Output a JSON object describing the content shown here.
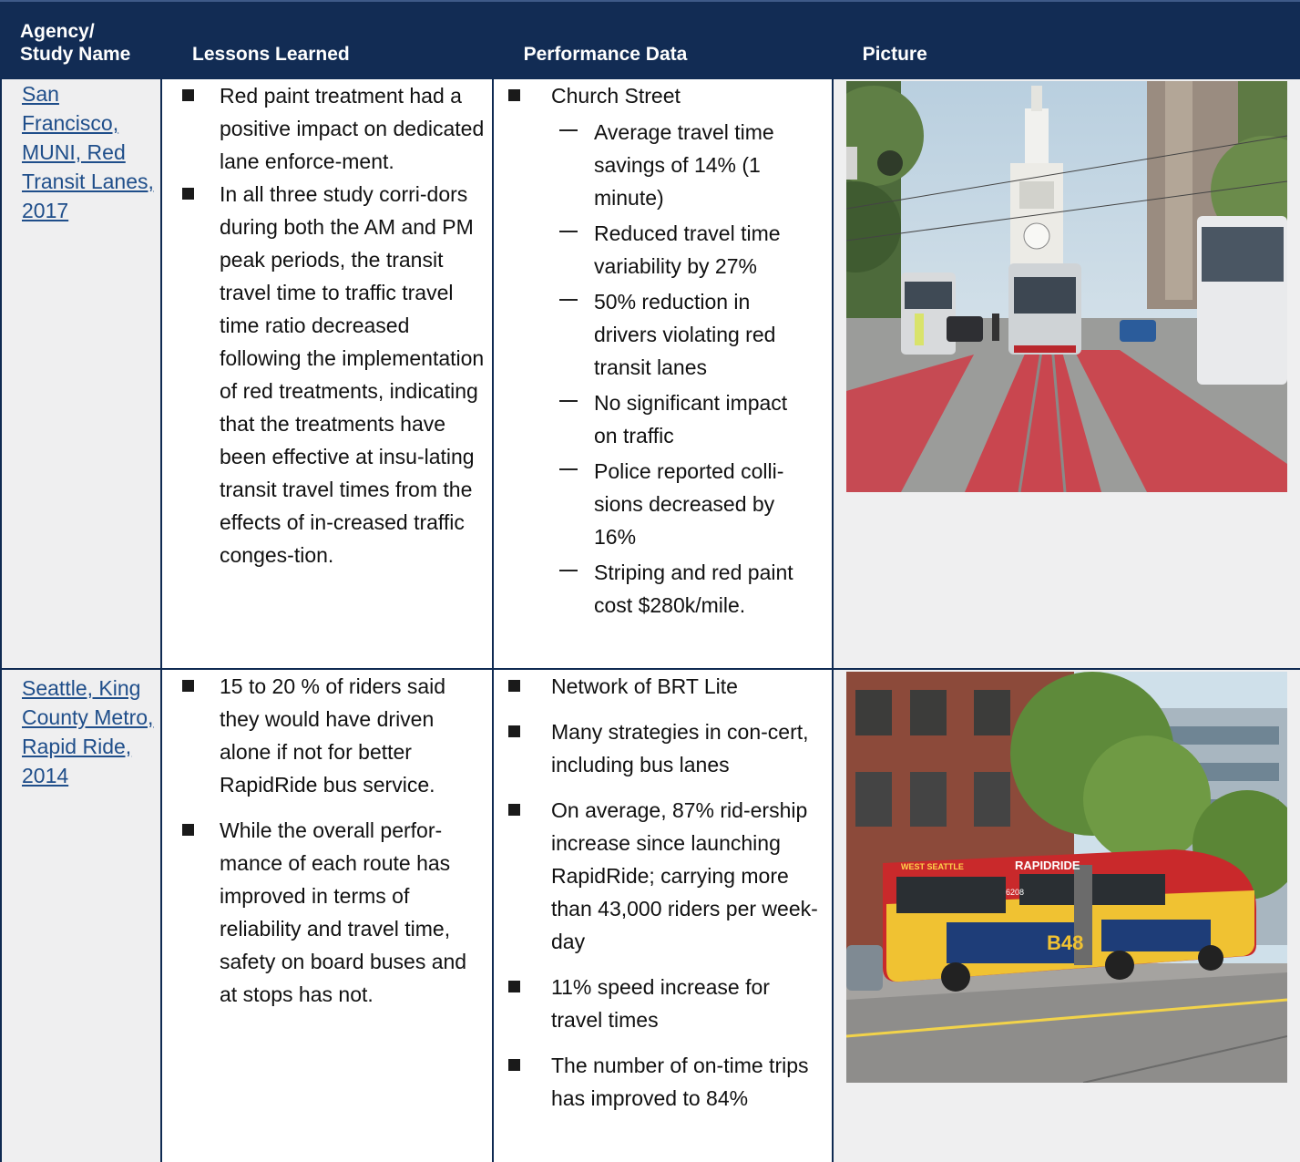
{
  "header": {
    "col1": "Agency/\nStudy Name",
    "col2": "Lessons Learned",
    "col3": "Performance Data",
    "col4": "Picture"
  },
  "rows": [
    {
      "agency": "San Francisco, MUNI, Red Transit Lanes, 2017",
      "lessons": [
        "Red paint treatment had a positive impact on dedicated lane enforce-ment.",
        "In all three study corri-dors during both the AM and PM peak periods, the transit travel time to traffic travel time ratio decreased following the implementation of red treatments, indicating that the treatments have been effective at insu-lating transit travel times from the effects of in-creased traffic conges-tion."
      ],
      "performance": {
        "heading": "Church Street",
        "items": [
          "Average travel time savings of 14% (1 minute)",
          "Reduced travel time variability by 27%",
          "50% reduction in drivers violating red transit lanes",
          "No significant impact on traffic",
          "Police reported colli-sions decreased by 16%",
          "Striping and red paint cost $280k/mile."
        ]
      }
    },
    {
      "agency": "Seattle, King County Metro, Rapid Ride, 2014",
      "lessons": [
        "15 to 20 % of riders said they would have driven alone if not for better RapidRide bus service.",
        "While the overall perfor-mance of each route has improved in terms of reliability and travel time, safety on board buses and at stops has not."
      ],
      "performance": {
        "items": [
          "Network of BRT Lite",
          "Many strategies in con-cert, including bus lanes",
          "On average, 87% rid-ership increase since launching RapidRide; carrying more than 43,000 riders per week-day",
          "11% speed increase for travel times",
          "The number of on-time trips has improved to 84%"
        ]
      },
      "photo_text": {
        "brand": "RAPIDRIDE",
        "sign": "WEST SEATTLE",
        "fleet": "6208",
        "route": "B48"
      }
    }
  ]
}
